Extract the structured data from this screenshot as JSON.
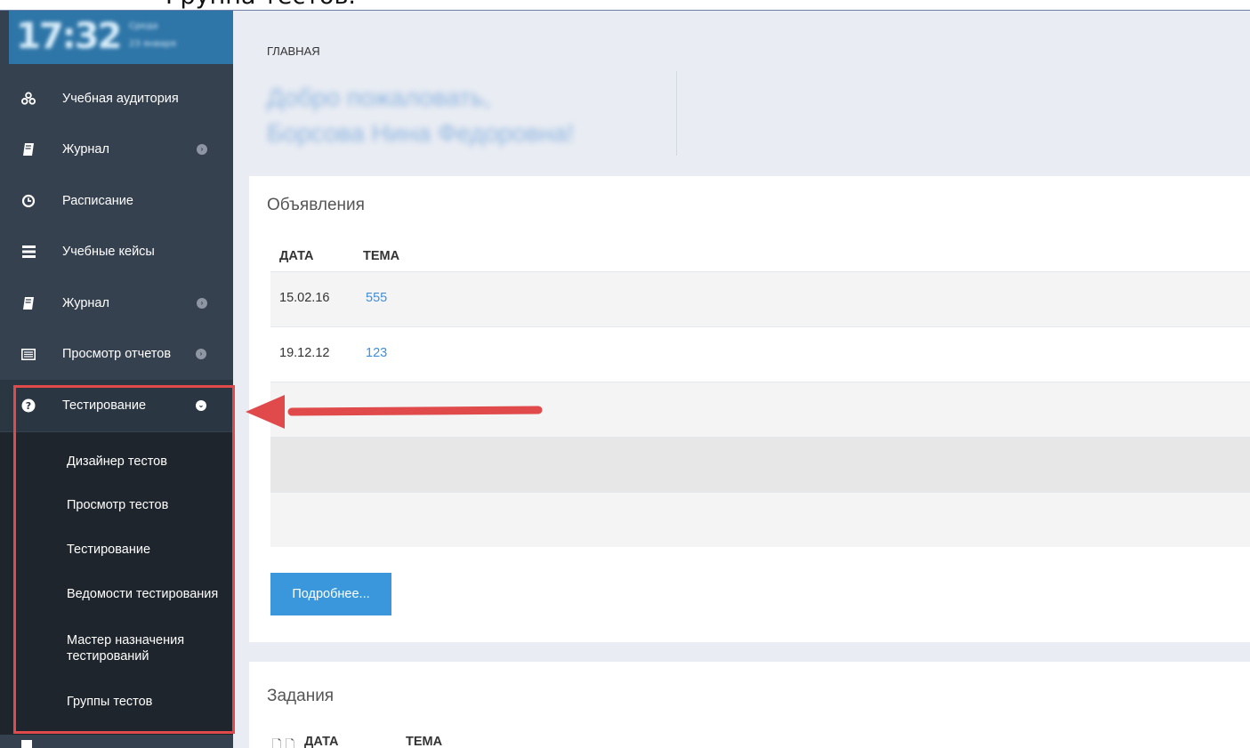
{
  "document_caption": "Группа тестов.",
  "clock": {
    "time": "17:32",
    "day": "Среда",
    "date": "23 января"
  },
  "sidebar": {
    "items": [
      {
        "label": "Учебная аудитория",
        "icon": "users-group-icon",
        "has_arrow": false
      },
      {
        "label": "Журнал",
        "icon": "book-icon",
        "has_arrow": true
      },
      {
        "label": "Расписание",
        "icon": "clock-icon",
        "has_arrow": false
      },
      {
        "label": "Учебные кейсы",
        "icon": "list-icon",
        "has_arrow": false
      },
      {
        "label": "Журнал",
        "icon": "book-icon",
        "has_arrow": true
      },
      {
        "label": "Просмотр отчетов",
        "icon": "report-icon",
        "has_arrow": true
      },
      {
        "label": "Тестирование",
        "icon": "question-circle-icon",
        "has_arrow": true,
        "expanded": true
      }
    ],
    "submenu": [
      {
        "label": "Дизайнер тестов"
      },
      {
        "label": "Просмотр тестов"
      },
      {
        "label": "Тестирование"
      },
      {
        "label": "Ведомости тестирования"
      },
      {
        "label": "Мастер назначения тестирований"
      },
      {
        "label": "Группы тестов"
      }
    ]
  },
  "main": {
    "breadcrumb": "ГЛАВНАЯ",
    "welcome_line1": "Добро пожаловать,",
    "welcome_line2": "Борсова Нина Федоровна!",
    "announcements": {
      "title": "Объявления",
      "col_date": "ДАТА",
      "col_topic": "ТЕМА",
      "rows": [
        {
          "date": "15.02.16",
          "topic": "555"
        },
        {
          "date": "19.12.12",
          "topic": "123"
        }
      ],
      "more_label": "Подробнее..."
    },
    "tasks": {
      "title": "Задания",
      "col_date": "ДАТА",
      "col_topic": "ТЕМА"
    }
  },
  "colors": {
    "sidebar_bg": "#364150",
    "submenu_bg": "#1f252c",
    "accent": "#3a97dc",
    "link": "#3f8fd8",
    "highlight": "#e04a4a"
  }
}
